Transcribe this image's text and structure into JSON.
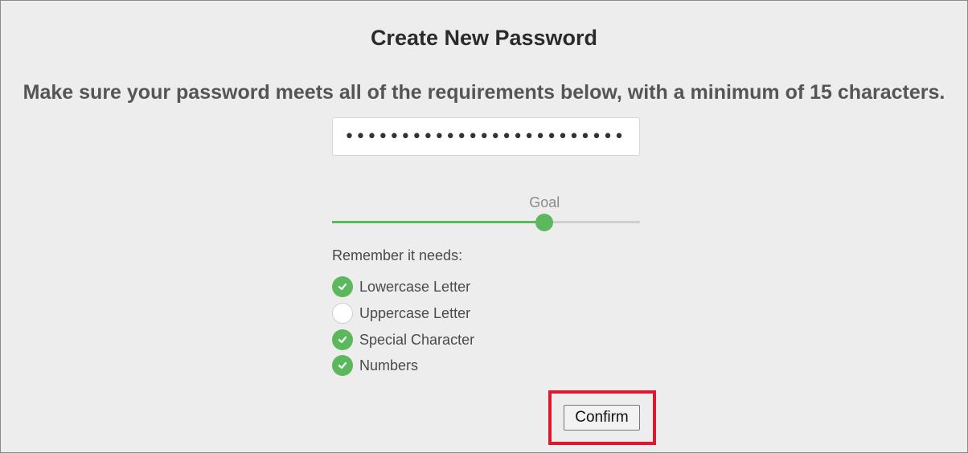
{
  "page": {
    "title": "Create New Password",
    "instructions": "Make sure your password meets all of the requirements below, with a minimum of 15 characters."
  },
  "password_field": {
    "value": "•••••••••••••••••••••••••"
  },
  "strength_meter": {
    "goal_label": "Goal",
    "level": 0.69,
    "goal_position": 0.69
  },
  "requirements": {
    "heading": "Remember it needs:",
    "items": [
      {
        "label": "Lowercase Letter",
        "met": true,
        "icon": "check-circle-icon"
      },
      {
        "label": "Uppercase Letter",
        "met": false,
        "icon": "empty-circle-icon"
      },
      {
        "label": "Special Character",
        "met": true,
        "icon": "check-circle-icon"
      },
      {
        "label": "Numbers",
        "met": true,
        "icon": "check-circle-icon"
      }
    ]
  },
  "actions": {
    "confirm_label": "Confirm"
  },
  "colors": {
    "success": "#5cb85c",
    "highlight": "#e0182e",
    "background": "#ededed"
  }
}
